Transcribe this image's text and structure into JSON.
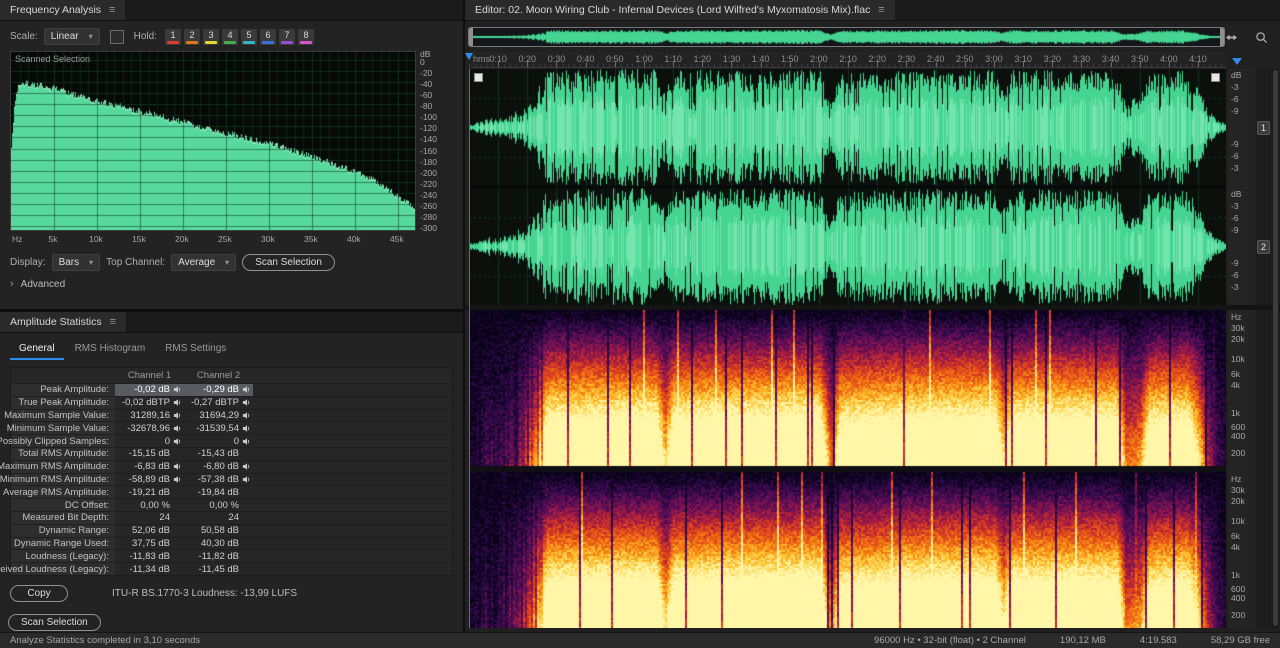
{
  "ui": {
    "caret": "▾",
    "advanced_arrow": "›"
  },
  "frequency_panel": {
    "title": "Frequency Analysis",
    "menu_icon": "≡",
    "scale_label": "Scale:",
    "scale_value": "Linear",
    "hold_label": "Hold:",
    "hold_buttons": [
      {
        "label": "1",
        "color": "#e03c32"
      },
      {
        "label": "2",
        "color": "#e0761f"
      },
      {
        "label": "3",
        "color": "#e6d92e"
      },
      {
        "label": "4",
        "color": "#43b049"
      },
      {
        "label": "5",
        "color": "#2fb6c8"
      },
      {
        "label": "6",
        "color": "#3a6fd8"
      },
      {
        "label": "7",
        "color": "#9050d8"
      },
      {
        "label": "8",
        "color": "#d855c8"
      }
    ],
    "plot": {
      "corner_label": "Scanned Selection",
      "x_unit": "Hz",
      "x_ticks": [
        "5k",
        "10k",
        "15k",
        "20k",
        "25k",
        "30k",
        "35k",
        "40k",
        "45k"
      ],
      "y_unit": "dB",
      "y_ticks": [
        "0",
        "-20",
        "-40",
        "-60",
        "-80",
        "-100",
        "-120",
        "-140",
        "-160",
        "-180",
        "-200",
        "-220",
        "-240",
        "-260",
        "-280",
        "-300"
      ]
    },
    "display_label": "Display:",
    "display_value": "Bars",
    "top_channel_label": "Top Channel:",
    "top_channel_value": "Average",
    "scan_button": "Scan Selection",
    "advanced_label": "Advanced"
  },
  "amplitude_panel": {
    "title": "Amplitude Statistics",
    "menu_icon": "≡",
    "tabs": [
      "General",
      "RMS Histogram",
      "RMS Settings"
    ],
    "active_tab": "General",
    "columns": [
      "Channel 1",
      "Channel 2"
    ],
    "rows": [
      {
        "label": "Peak Amplitude:",
        "ch1": "-0,02 dB",
        "ch2": "-0,29 dB",
        "speaker": true,
        "selected": true
      },
      {
        "label": "True Peak Amplitude:",
        "ch1": "-0,02 dBTP",
        "ch2": "-0,27 dBTP",
        "speaker": true
      },
      {
        "label": "Maximum Sample Value:",
        "ch1": "31289,16",
        "ch2": "31694,29",
        "speaker": true
      },
      {
        "label": "Minimum Sample Value:",
        "ch1": "-32678,96",
        "ch2": "-31539,54",
        "speaker": true
      },
      {
        "label": "Possibly Clipped Samples:",
        "ch1": "0",
        "ch2": "0",
        "speaker": true
      },
      {
        "label": "Total RMS Amplitude:",
        "ch1": "-15,15 dB",
        "ch2": "-15,43 dB",
        "speaker": false
      },
      {
        "label": "Maximum RMS Amplitude:",
        "ch1": "-6,83 dB",
        "ch2": "-6,80 dB",
        "speaker": true
      },
      {
        "label": "Minimum RMS Amplitude:",
        "ch1": "-58,89 dB",
        "ch2": "-57,38 dB",
        "speaker": true
      },
      {
        "label": "Average RMS Amplitude:",
        "ch1": "-19,21 dB",
        "ch2": "-19,84 dB",
        "speaker": false
      },
      {
        "label": "DC Offset:",
        "ch1": "0,00 %",
        "ch2": "0,00 %",
        "speaker": false
      },
      {
        "label": "Measured Bit Depth:",
        "ch1": "24",
        "ch2": "24",
        "speaker": false
      },
      {
        "label": "Dynamic Range:",
        "ch1": "52,06 dB",
        "ch2": "50,58 dB",
        "speaker": false
      },
      {
        "label": "Dynamic Range Used:",
        "ch1": "37,75 dB",
        "ch2": "40,30 dB",
        "speaker": false
      },
      {
        "label": "Loudness (Legacy):",
        "ch1": "-11,83 dB",
        "ch2": "-11,82 dB",
        "speaker": false
      },
      {
        "label": "Perceived Loudness (Legacy):",
        "ch1": "-11,34 dB",
        "ch2": "-11,45 dB",
        "speaker": false
      }
    ],
    "copy_button": "Copy",
    "loudness_text": "ITU-R BS.1770-3 Loudness: -13,99 LUFS",
    "scan_button": "Scan Selection"
  },
  "editor": {
    "title": "Editor: 02. Moon Wiring Club - Infernal Devices (Lord Wilfred's Myxomatosis Mix).flac",
    "menu_icon": "≡",
    "ruler_unit": "hms",
    "ruler_labels": [
      "0:10",
      "0:20",
      "0:30",
      "0:40",
      "0:50",
      "1:00",
      "1:10",
      "1:20",
      "1:30",
      "1:40",
      "1:50",
      "2:00",
      "2:10",
      "2:20",
      "2:30",
      "2:40",
      "2:50",
      "3:00",
      "3:10",
      "3:20",
      "3:30",
      "3:40",
      "3:50",
      "4:00",
      "4:10"
    ],
    "duration_seconds": 259.583,
    "wave_scale": [
      {
        "label": "dB",
        "pos": 0.01
      },
      {
        "label": "-3",
        "pos": 0.115
      },
      {
        "label": "-6",
        "pos": 0.215
      },
      {
        "label": "-9",
        "pos": 0.315
      },
      {
        "label": "-9",
        "pos": 0.6
      },
      {
        "label": "-6",
        "pos": 0.7
      },
      {
        "label": "-3",
        "pos": 0.8
      }
    ],
    "spec_scale": [
      {
        "label": "Hz",
        "pos": 0.012
      },
      {
        "label": "30k",
        "pos": 0.085
      },
      {
        "label": "20k",
        "pos": 0.155
      },
      {
        "label": "10k",
        "pos": 0.285
      },
      {
        "label": "6k",
        "pos": 0.375
      },
      {
        "label": "4k",
        "pos": 0.45
      },
      {
        "label": "1k",
        "pos": 0.625
      },
      {
        "label": "600",
        "pos": 0.715
      },
      {
        "label": "400",
        "pos": 0.775
      },
      {
        "label": "200",
        "pos": 0.885
      }
    ],
    "channel_badges": [
      "1",
      "2"
    ],
    "waveform_envelope": [
      [
        0,
        0.05
      ],
      [
        3,
        0.1
      ],
      [
        6,
        0.16
      ],
      [
        10,
        0.14
      ],
      [
        14,
        0.22
      ],
      [
        18,
        0.3
      ],
      [
        22,
        0.5
      ],
      [
        25,
        0.75
      ],
      [
        27,
        0.9
      ],
      [
        64,
        0.92
      ],
      [
        67,
        0.55
      ],
      [
        70,
        0.9
      ],
      [
        120,
        0.93
      ],
      [
        124,
        0.38
      ],
      [
        127,
        0.85
      ],
      [
        150,
        0.9
      ],
      [
        180,
        0.92
      ],
      [
        183,
        0.6
      ],
      [
        186,
        0.9
      ],
      [
        222,
        0.9
      ],
      [
        225,
        0.42
      ],
      [
        230,
        0.48
      ],
      [
        233,
        0.85
      ],
      [
        246,
        0.9
      ],
      [
        250,
        0.62
      ],
      [
        253,
        0.3
      ],
      [
        256,
        0.14
      ],
      [
        259.583,
        0.05
      ]
    ],
    "colors": {
      "waveform_green": "#45d492",
      "playhead_red": "#e03a2a",
      "handle_blue": "#2f8ce8"
    }
  },
  "status_bar": {
    "left": "Analyze Statistics completed in 3,10 seconds",
    "format": "96000 Hz • 32-bit (float) • 2 Channel",
    "file_size": "190,12 MB",
    "duration": "4:19.583",
    "free_space": "58,29 GB free"
  }
}
